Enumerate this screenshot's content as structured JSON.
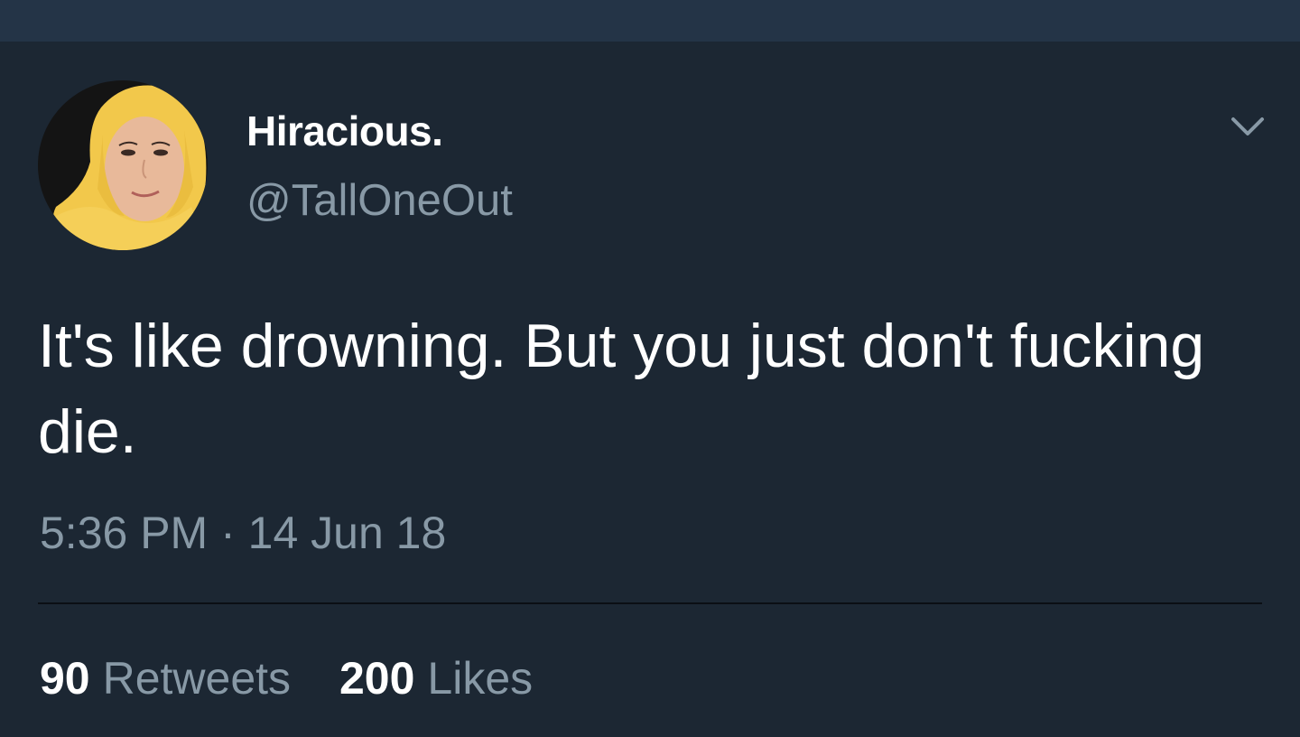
{
  "tweet": {
    "author": {
      "display_name": "Hiracious.",
      "handle": "@TallOneOut"
    },
    "text": "It's like drowning. But you just don't fucking die.",
    "timestamp": "5:36 PM · 14 Jun 18",
    "stats": {
      "retweets_count": "90",
      "retweets_label": "Retweets",
      "likes_count": "200",
      "likes_label": "Likes"
    },
    "menu_icon": "chevron-down-icon",
    "avatar_icon": "avatar"
  },
  "colors": {
    "background": "#1c2733",
    "top_bar": "#243447",
    "text_primary": "#ffffff",
    "text_secondary": "#8899a6",
    "divider": "#0b0f14"
  }
}
